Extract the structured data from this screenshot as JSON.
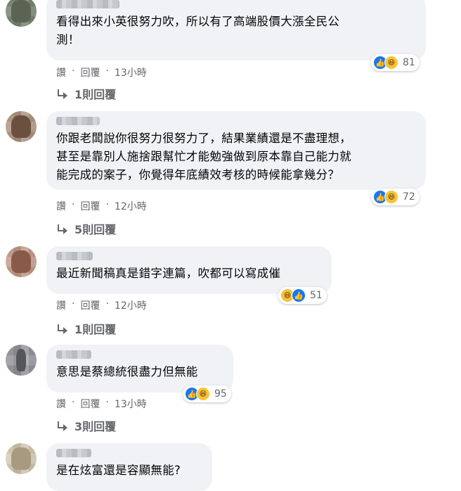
{
  "comments": [
    {
      "text_lines": [
        "看得出來小英很努力吹，所以有了高端股價大漲全民公",
        "測！"
      ],
      "meta": {
        "read": "讚",
        "reply": "回覆",
        "time": "13小時"
      },
      "reactions": {
        "icons": [
          "like-icon",
          "haha-icon"
        ],
        "count": "81"
      },
      "replies": "1則回覆"
    },
    {
      "text_lines": [
        "你跟老闆說你很努力很努力了，結果業績還是不盡理想，",
        "甚至是靠別人施捨跟幫忙才能勉強做到原本靠自己能力就",
        "能完成的案子，你覺得年底績效考核的時候能拿幾分？"
      ],
      "meta": {
        "read": "讚",
        "reply": "回覆",
        "time": "12小時"
      },
      "reactions": {
        "icons": [
          "like-icon",
          "haha-icon"
        ],
        "count": "72"
      },
      "replies": "5則回覆"
    },
    {
      "text_lines": [
        "最近新聞稿真是錯字連篇，吹都可以寫成催"
      ],
      "meta": {
        "read": "讚",
        "reply": "回覆",
        "time": "12小時"
      },
      "reactions": {
        "icons": [
          "haha-icon",
          "like-icon"
        ],
        "count": "51"
      },
      "replies": "1則回覆"
    },
    {
      "text_lines": [
        "意思是蔡總統很盡力但無能"
      ],
      "meta": {
        "read": "讚",
        "reply": "回覆",
        "time": "13小時"
      },
      "reactions": {
        "icons": [
          "like-icon",
          "haha-icon"
        ],
        "count": "95"
      },
      "replies": "3則回覆"
    },
    {
      "text_lines": [
        "是在炫富還是容顯無能?"
      ]
    }
  ],
  "colors": {
    "bubble": "#f0f2f5",
    "meta": "#65676b",
    "like": "#1877f2",
    "haha": "#f7c33a"
  }
}
